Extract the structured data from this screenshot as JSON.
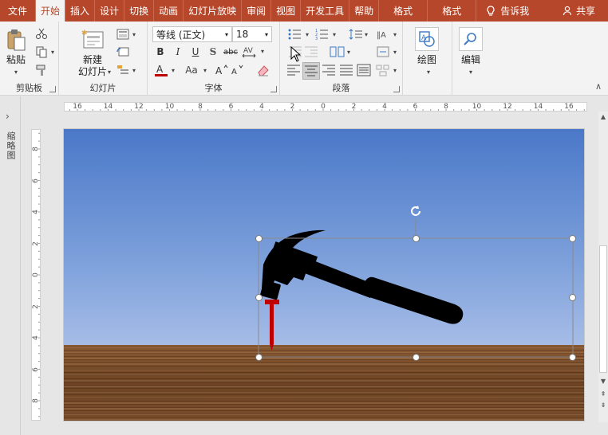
{
  "tabs": {
    "file": "文件",
    "home": "开始",
    "insert": "插入",
    "design": "设计",
    "transitions": "切换",
    "animations": "动画",
    "slideshow": "幻灯片放映",
    "review": "审阅",
    "view": "视图",
    "developer": "开发工具",
    "help": "帮助",
    "format1": "格式",
    "format2": "格式",
    "tell_me": "告诉我",
    "share": "共享"
  },
  "ribbon": {
    "clipboard": {
      "paste_label": "粘贴",
      "group_label": "剪贴板"
    },
    "slides": {
      "new_slide_line1": "新建",
      "new_slide_line2": "幻灯片",
      "group_label": "幻灯片"
    },
    "font": {
      "font_name": "等线 (正文)",
      "font_size": "18",
      "bold": "B",
      "italic": "I",
      "underline": "U",
      "shadow": "S",
      "strike": "abc",
      "case": "Aa",
      "group_label": "字体"
    },
    "paragraph": {
      "group_label": "段落"
    },
    "drawing": {
      "label": "绘图"
    },
    "editing": {
      "label": "编辑"
    }
  },
  "left_pane": {
    "label": "缩略图"
  },
  "hruler": [
    "16",
    "14",
    "12",
    "10",
    "8",
    "6",
    "4",
    "2",
    "0",
    "2",
    "4",
    "6",
    "8",
    "10",
    "12",
    "14",
    "16"
  ],
  "vruler": [
    "8",
    "6",
    "4",
    "2",
    "0",
    "2",
    "4",
    "6",
    "8"
  ],
  "colors": {
    "accent": "#b7472a",
    "handle": "#ffffff",
    "nail": "#c00000",
    "hammer": "#000000"
  }
}
